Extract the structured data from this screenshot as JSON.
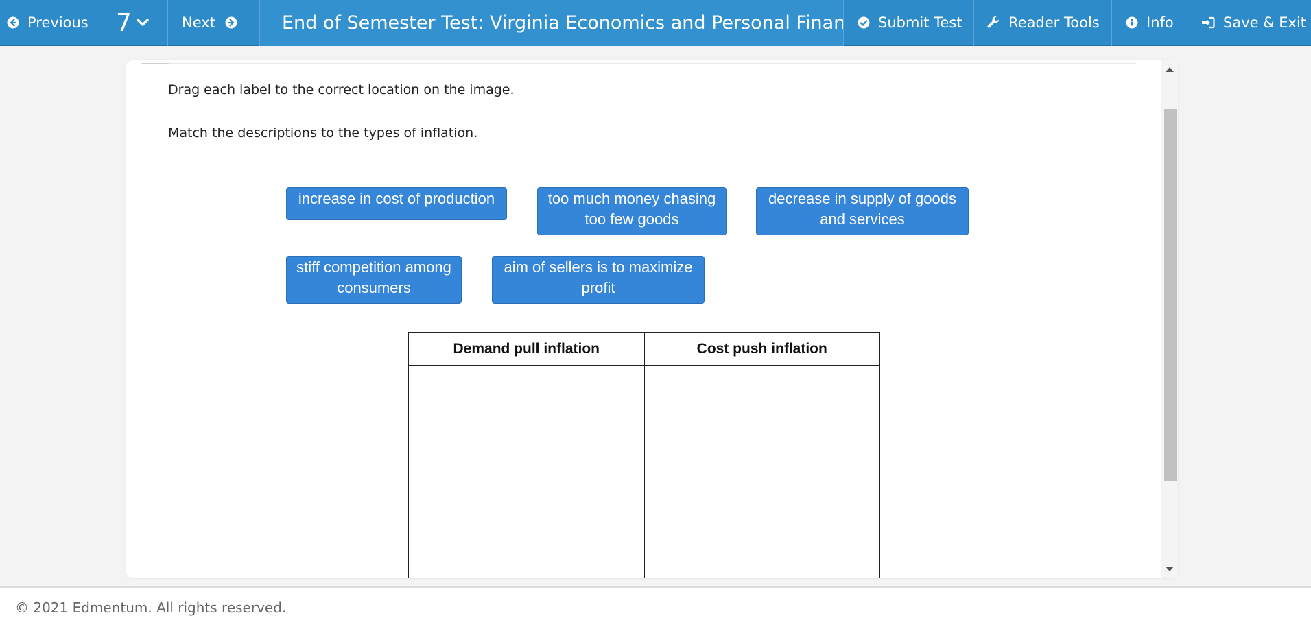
{
  "toolbar": {
    "previous_label": "Previous",
    "question_number": "7",
    "next_label": "Next",
    "test_title": "End of Semester Test: Virginia Economics and Personal Finance A",
    "submit_label": "Submit Test",
    "reader_tools_label": "Reader Tools",
    "info_label": "Info",
    "save_exit_label": "Save & Exit",
    "bar_color": "#2e8bc9"
  },
  "question": {
    "instruction": "Drag each label to the correct location on the image.",
    "prompt": "Match the descriptions to the types of inflation.",
    "labels": [
      "increase in cost of production",
      "too much money chasing too few goods",
      "decrease in supply of goods and services",
      "stiff competition among consumers",
      "aim of sellers is to maximize profit"
    ],
    "label_color": "#3585d9",
    "table": {
      "headers": [
        "Demand pull inflation",
        "Cost push inflation"
      ]
    }
  },
  "footer": {
    "copyright": "© 2021 Edmentum. All rights reserved."
  }
}
